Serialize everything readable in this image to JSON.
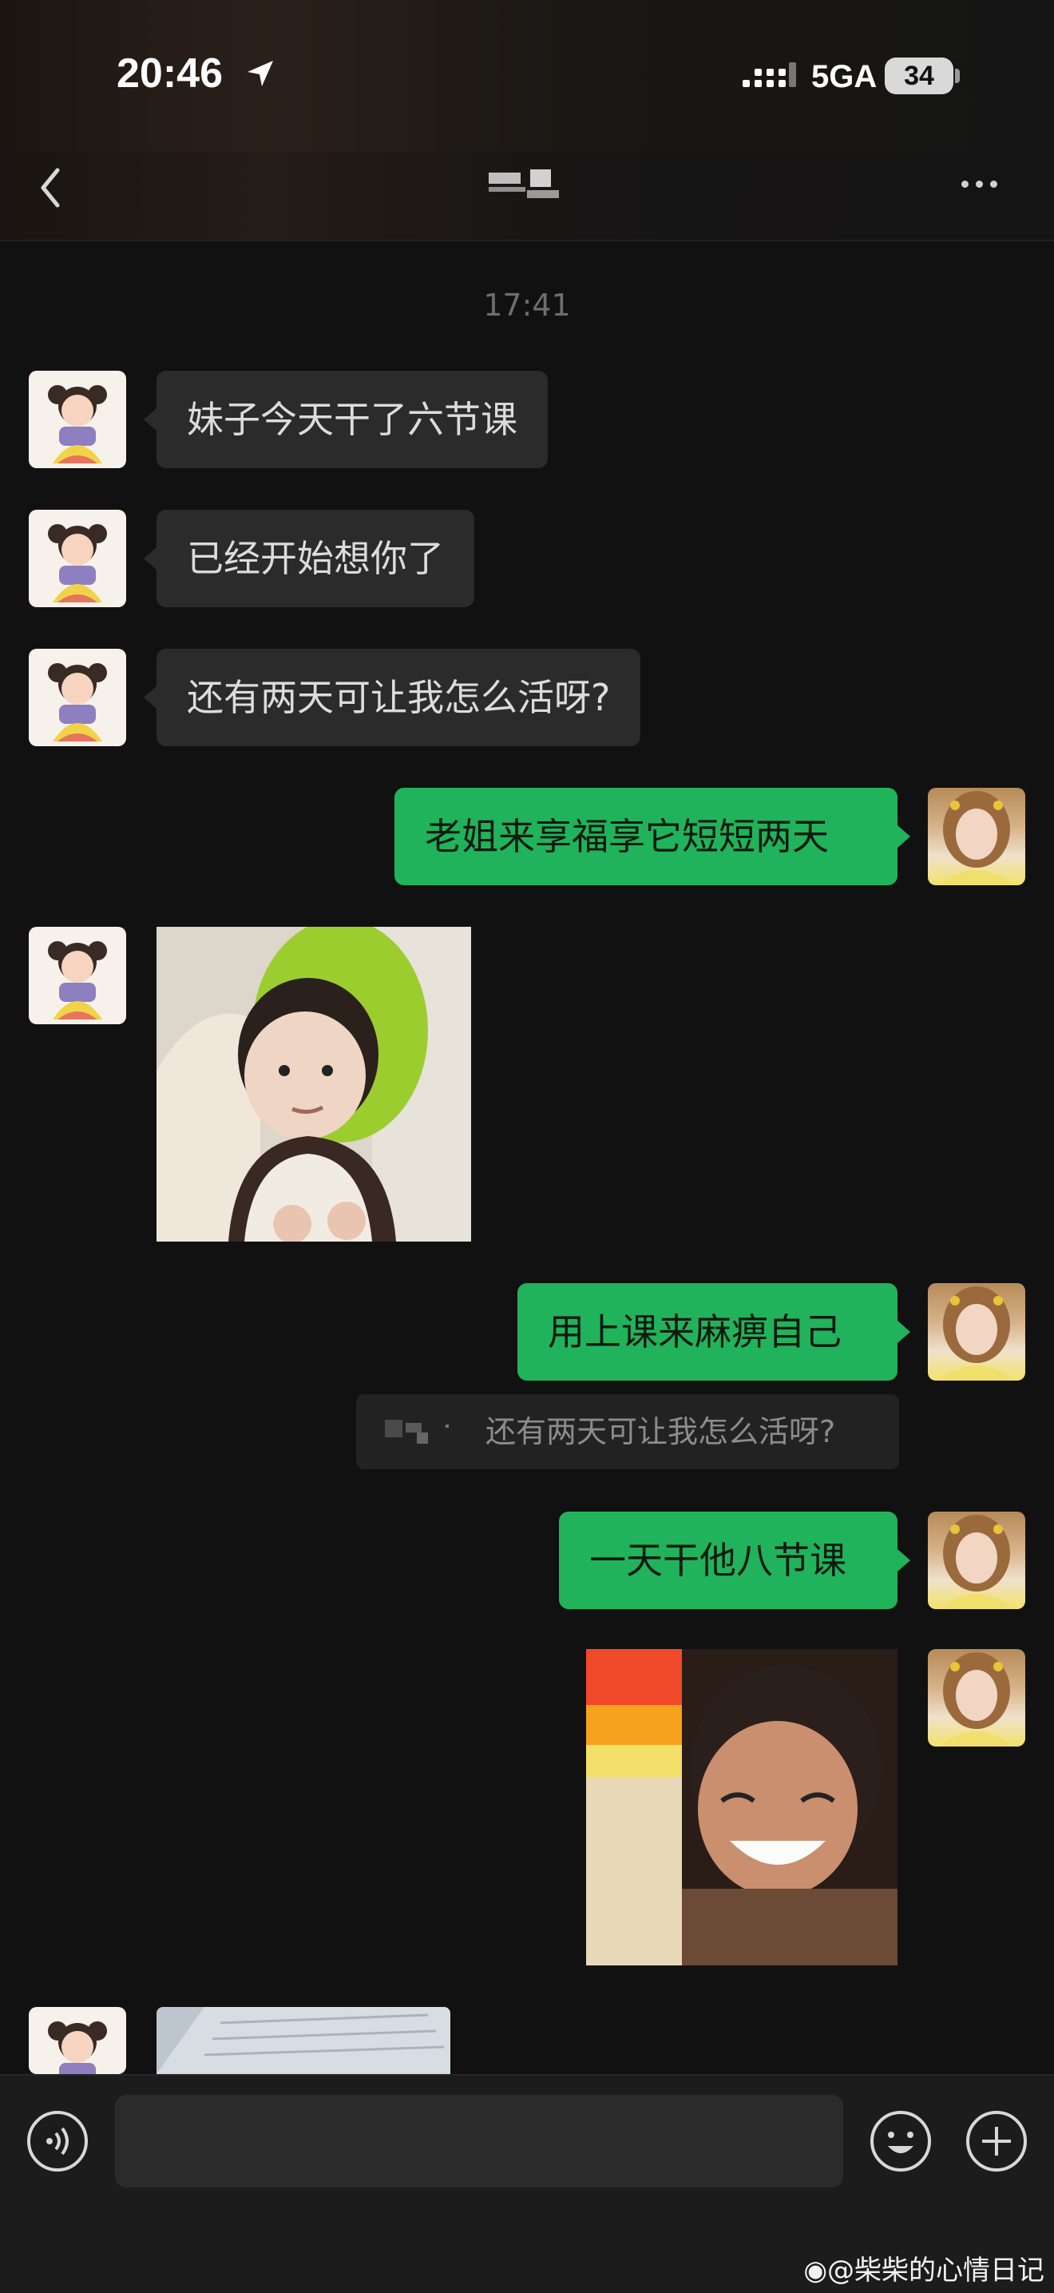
{
  "status_bar": {
    "time": "20:46",
    "network": "5GA",
    "battery": "34"
  },
  "header": {
    "back_icon": "chevron-left-icon",
    "more_icon": "more-dots-icon"
  },
  "chat": {
    "timestamp": "17:41",
    "messages": [
      {
        "side": "in",
        "text": "妹子今天干了六节课"
      },
      {
        "side": "in",
        "text": "已经开始想你了"
      },
      {
        "side": "in",
        "text": "还有两天可让我怎么活呀?"
      },
      {
        "side": "out",
        "text": "老姐来享福享它短短两天"
      },
      {
        "side": "in",
        "type": "image",
        "content": "toddler-sticker"
      },
      {
        "side": "out",
        "text": "用上课来麻痹自己"
      },
      {
        "side": "out",
        "type": "quote",
        "text": "还有两天可让我怎么活呀?"
      },
      {
        "side": "out",
        "text": "一天干他八节课"
      },
      {
        "side": "out",
        "type": "image",
        "content": "laughing-child-sticker"
      },
      {
        "side": "in",
        "type": "image",
        "content": "photo-partial"
      }
    ]
  },
  "input_bar": {
    "placeholder": "",
    "voice_icon": "voice-icon",
    "emoji_icon": "emoji-icon",
    "plus_icon": "plus-icon"
  },
  "watermark": "@柴柴的心情日记",
  "colors": {
    "background": "#111111",
    "outgoing_bubble": "#21b35b",
    "incoming_bubble": "#2b2b2b"
  }
}
